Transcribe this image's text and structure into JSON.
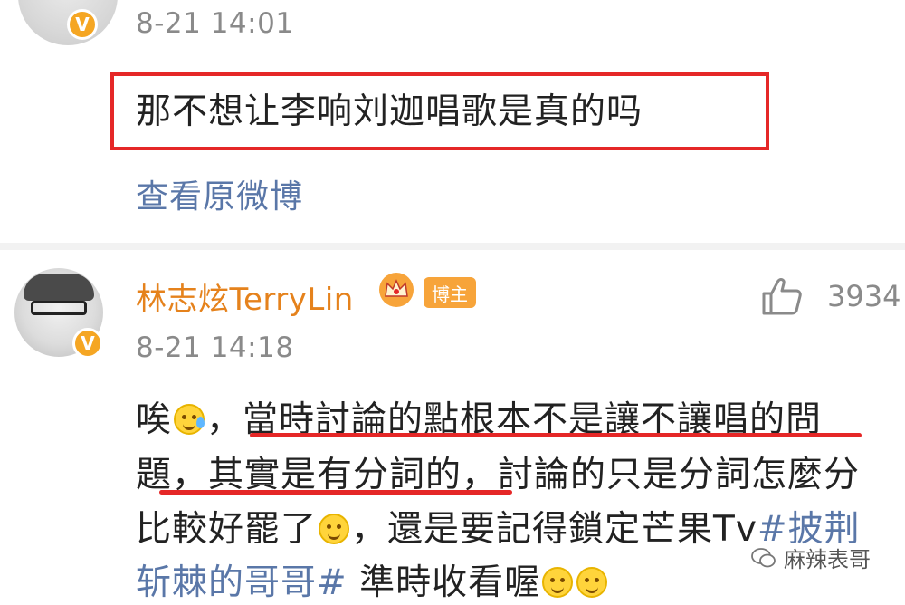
{
  "top_comment": {
    "avatar_icon": "user-avatar-icon",
    "verified_badge": "V",
    "time": "8-21 14:01",
    "text": "那不想让李响刘迦唱歌是真的吗",
    "highlight_color": "#e52727",
    "view_original_label": "查看原微博"
  },
  "reply": {
    "username": "林志炫TerryLin",
    "crown_icon": "crown-icon",
    "author_tag": "博主",
    "verified_badge": "V",
    "like_icon": "thumbs-up-icon",
    "like_count": "3934",
    "time": "8-21 14:18",
    "lines": [
      {
        "a": "唉",
        "b": "，當時討論的點根本不是讓不讓唱的問"
      },
      {
        "a": "題，其實是有分詞的，討論的只是分詞怎麼分"
      },
      {
        "a": "比較好罷了",
        "b": "，還是要記得鎖定芒果Tv",
        "hashtag": "#披荆"
      },
      {
        "hashtag": "斩棘的哥哥#",
        "b": " 準時收看喔"
      }
    ],
    "underline_color": "#e52727"
  },
  "colors": {
    "username": "#e5821c",
    "link": "#5a77a8",
    "timestamp": "#8a8a8a",
    "badge": "#f5a623"
  },
  "watermark": {
    "icon": "wechat-icon",
    "text": "麻辣表哥"
  }
}
